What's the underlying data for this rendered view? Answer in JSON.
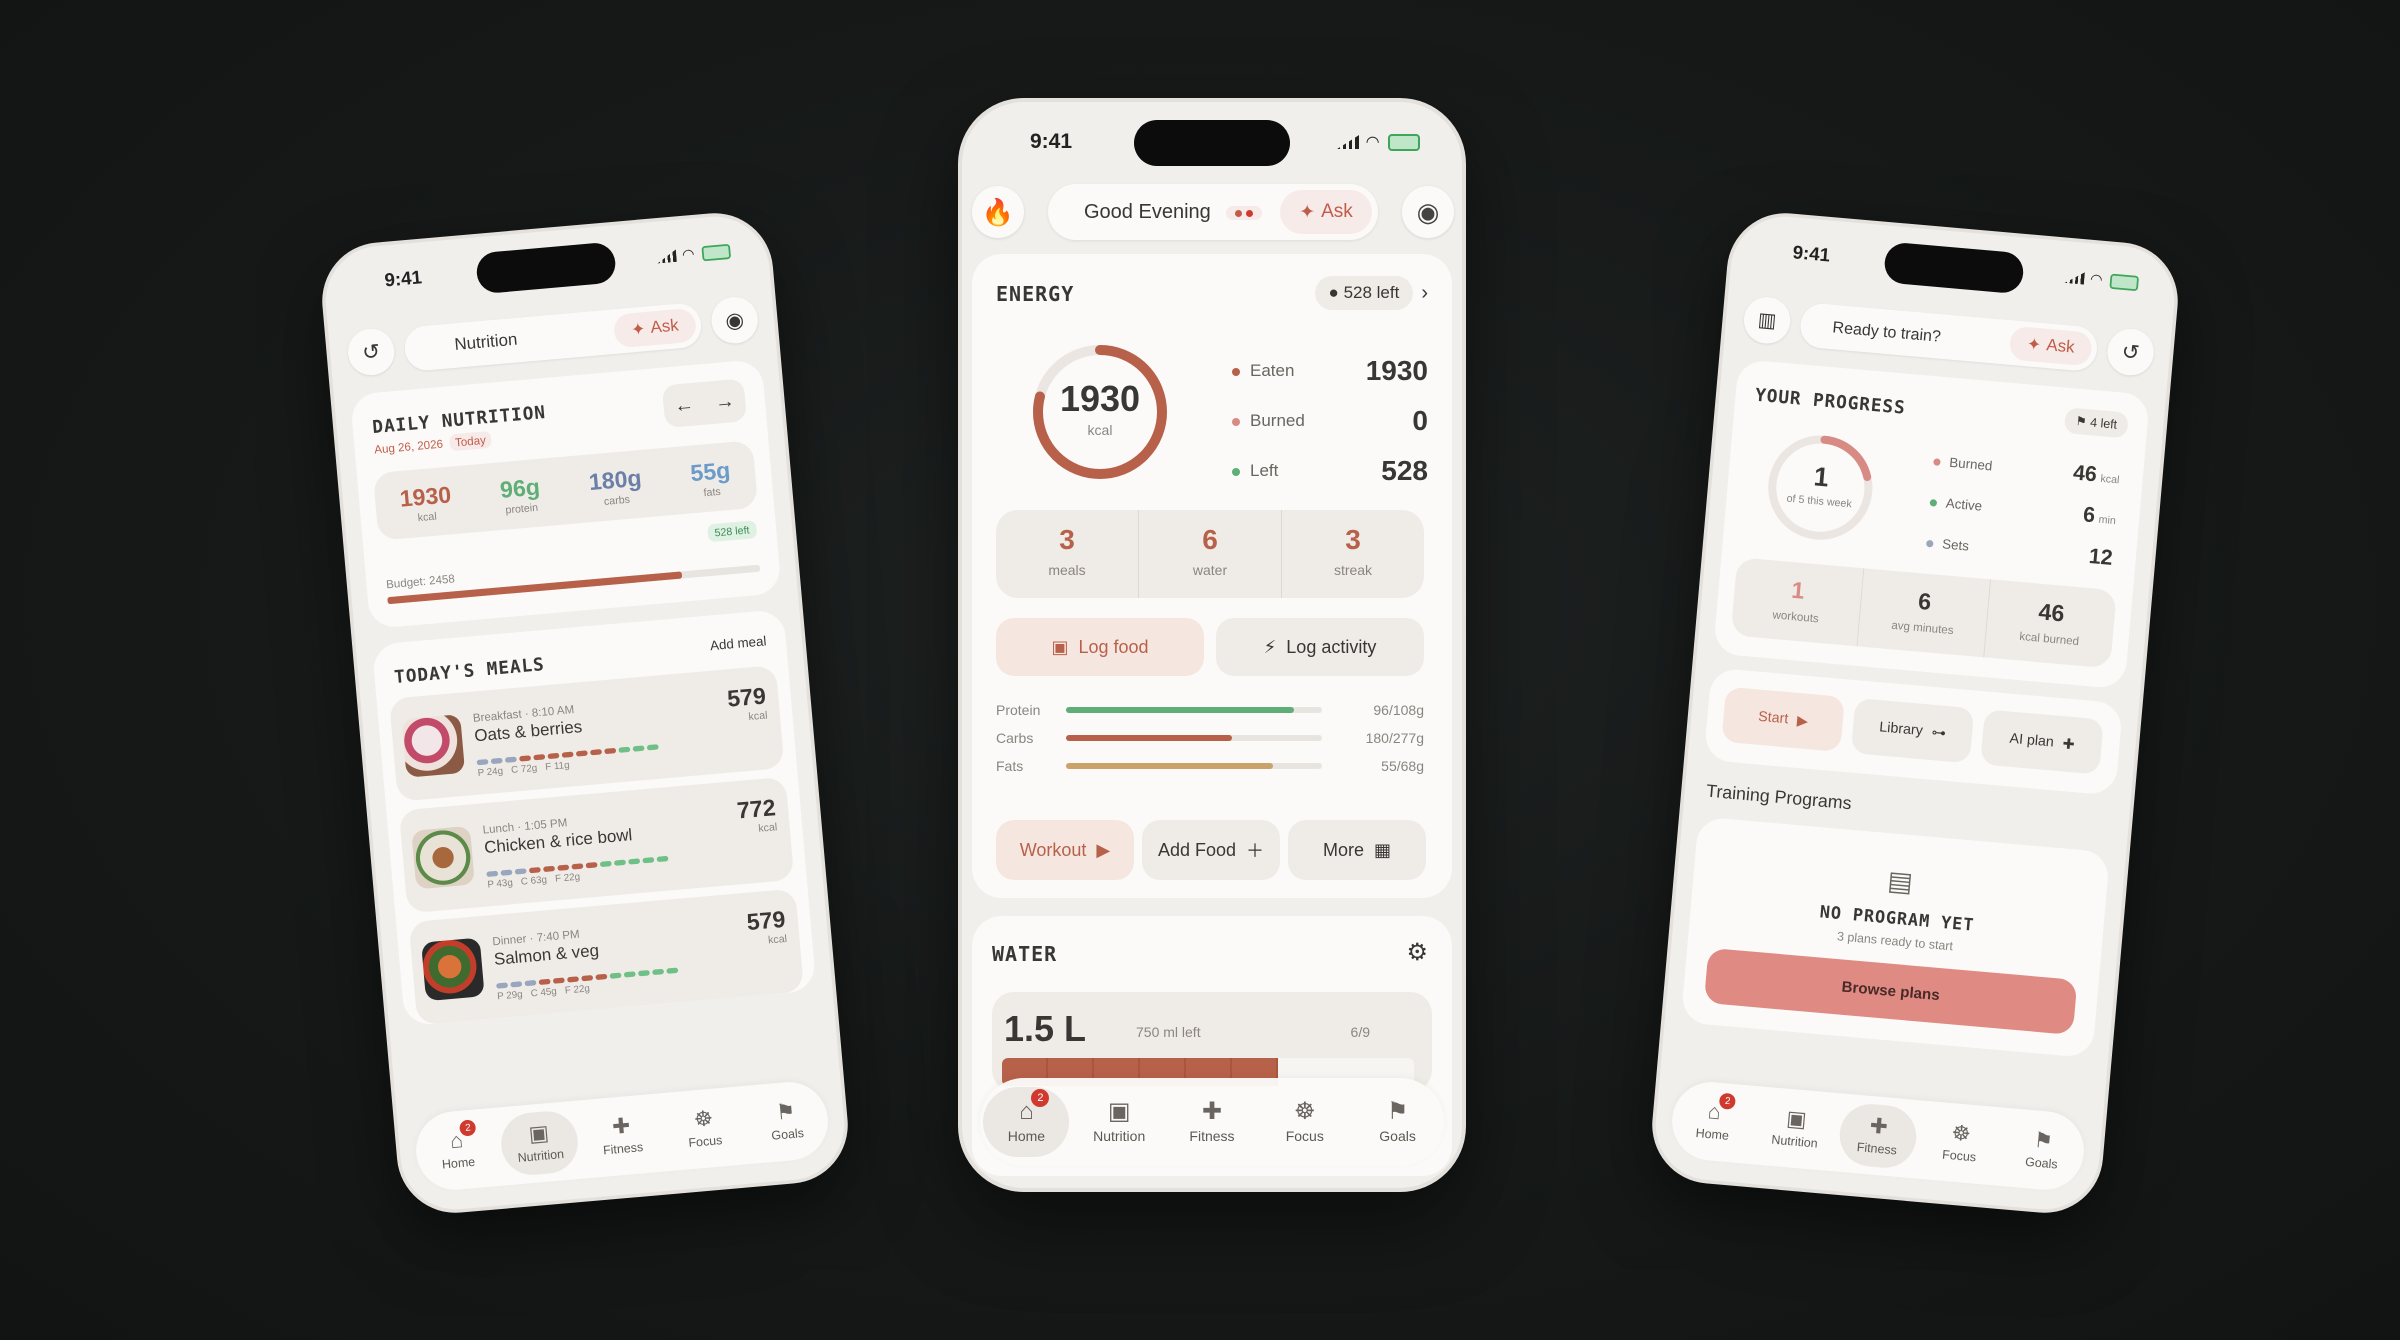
{
  "colors": {
    "accent": "#b8614a",
    "protein": "#5fae78",
    "carbs": "#b8614a",
    "fats": "#c9a36a",
    "dots_eaten": "#b8614a",
    "dots_burned": "#d88a84",
    "dots_left": "#5fae78"
  },
  "center": {
    "status": {
      "time": "9:41"
    },
    "header": {
      "greeting": "Good Evening",
      "ask": "Ask"
    },
    "energy": {
      "title": "ENERGY",
      "left_badge": "528 left",
      "ring_value": "1930",
      "ring_unit": "kcal",
      "ring_fraction": 0.79,
      "rows": [
        {
          "label": "Eaten",
          "value": "1930"
        },
        {
          "label": "Burned",
          "value": "0"
        },
        {
          "label": "Left",
          "value": "528"
        }
      ],
      "stats": [
        {
          "value": "3",
          "label": "meals"
        },
        {
          "value": "6",
          "label": "water"
        },
        {
          "value": "3",
          "label": "streak"
        }
      ],
      "log_food": "Log food",
      "log_activity": "Log activity",
      "macros": [
        {
          "label": "Protein",
          "value": "96/108g",
          "fraction": 0.89
        },
        {
          "label": "Carbs",
          "value": "180/277g",
          "fraction": 0.65
        },
        {
          "label": "Fats",
          "value": "55/68g",
          "fraction": 0.81
        }
      ]
    },
    "quick": {
      "workout": "Workout",
      "add_food": "Add Food",
      "more": "More"
    },
    "water": {
      "title": "WATER",
      "amount": "1.5 L",
      "left": "750 ml left",
      "count": "6/9",
      "fraction": 0.67
    },
    "nav": [
      {
        "label": "Home",
        "badge": "2"
      },
      {
        "label": "Nutrition"
      },
      {
        "label": "Fitness"
      },
      {
        "label": "Focus"
      },
      {
        "label": "Goals"
      }
    ]
  },
  "left": {
    "status": {
      "time": "9:41"
    },
    "header": {
      "title": "Nutrition",
      "ask": "Ask"
    },
    "daily": {
      "title": "DAILY NUTRITION",
      "date": "Aug 26, 2026",
      "today": "Today",
      "stats": [
        {
          "value": "1930",
          "label": "kcal"
        },
        {
          "value": "96g",
          "label": "protein"
        },
        {
          "value": "180g",
          "label": "carbs"
        },
        {
          "value": "55g",
          "label": "fats"
        }
      ],
      "budget": "Budget: 2458",
      "left": "528 left",
      "fraction": 0.79
    },
    "meals": {
      "title": "TODAY'S MEALS",
      "add": "Add meal",
      "items": [
        {
          "meta": "Breakfast · 8:10 AM",
          "name": "Oats & berries",
          "kcal": "579",
          "unit": "kcal",
          "p": "24g",
          "c": "72g",
          "f": "11g"
        },
        {
          "meta": "Lunch · 1:05 PM",
          "name": "Chicken & rice bowl",
          "kcal": "772",
          "unit": "kcal",
          "p": "43g",
          "c": "63g",
          "f": "22g"
        },
        {
          "meta": "Dinner · 7:40 PM",
          "name": "Salmon & veg",
          "kcal": "579",
          "unit": "kcal",
          "p": "29g",
          "c": "45g",
          "f": "22g"
        }
      ]
    },
    "nav": [
      {
        "label": "Home",
        "badge": "2"
      },
      {
        "label": "Nutrition"
      },
      {
        "label": "Fitness"
      },
      {
        "label": "Focus"
      },
      {
        "label": "Goals"
      }
    ]
  },
  "right": {
    "status": {
      "time": "9:41"
    },
    "header": {
      "title": "Ready to train?",
      "ask": "Ask"
    },
    "progress": {
      "title": "YOUR PROGRESS",
      "left_badge": "4 left",
      "ring_value": "1",
      "ring_sub": "of 5 this week",
      "ring_fraction": 0.2,
      "rows": [
        {
          "label": "Burned",
          "value": "46",
          "unit": "kcal"
        },
        {
          "label": "Active",
          "value": "6",
          "unit": "min"
        },
        {
          "label": "Sets",
          "value": "12",
          "unit": ""
        }
      ],
      "stats": [
        {
          "value": "1",
          "label": "workouts"
        },
        {
          "value": "6",
          "label": "avg minutes"
        },
        {
          "value": "46",
          "label": "kcal burned"
        }
      ]
    },
    "actions": {
      "start": "Start",
      "library": "Library",
      "ai": "AI plan"
    },
    "programs": {
      "title": "Training Programs",
      "empty_title": "NO PROGRAM YET",
      "empty_sub": "3 plans ready to start",
      "browse": "Browse plans"
    },
    "nav": [
      {
        "label": "Home",
        "badge": "2"
      },
      {
        "label": "Nutrition"
      },
      {
        "label": "Fitness"
      },
      {
        "label": "Focus"
      },
      {
        "label": "Goals"
      }
    ]
  }
}
